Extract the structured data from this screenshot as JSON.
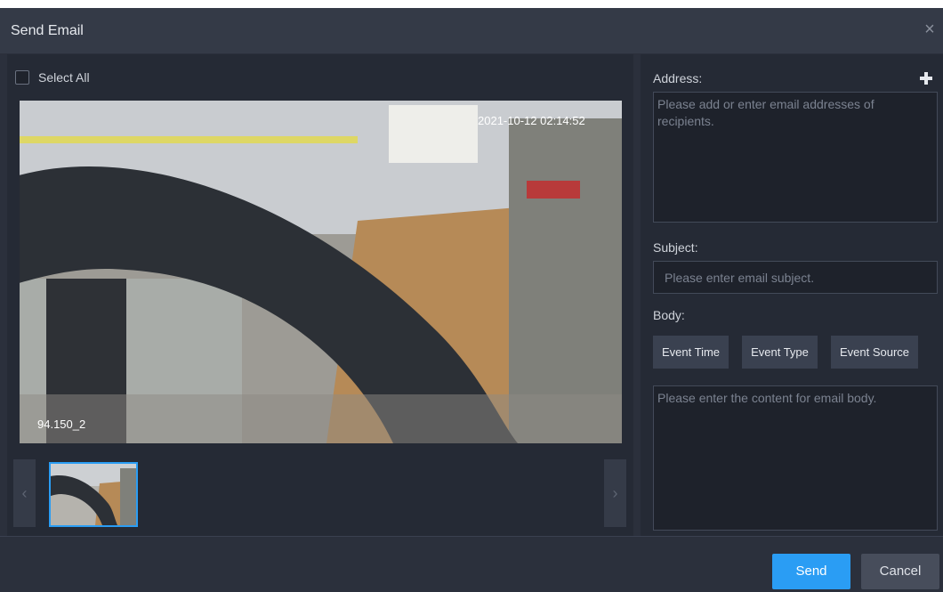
{
  "dialog": {
    "title": "Send Email"
  },
  "left": {
    "select_all_label": "Select All",
    "select_all_checked": false,
    "image": {
      "timestamp_overlay": "2021-10-12 02:14:52",
      "channel_overlay": "94.150_2"
    },
    "thumbnails": [
      {
        "selected": true
      }
    ],
    "prev_icon": "chevron-left-icon",
    "next_icon": "chevron-right-icon"
  },
  "right": {
    "address_label": "Address:",
    "address_placeholder": "Please add or enter email addresses of recipients.",
    "add_icon": "plus-icon",
    "subject_label": "Subject:",
    "subject_placeholder": "Please enter email subject.",
    "body_label": "Body:",
    "tags": [
      "Event Time",
      "Event Type",
      "Event Source"
    ],
    "body_placeholder": "Please enter the content for email body."
  },
  "footer": {
    "send_label": "Send",
    "cancel_label": "Cancel"
  },
  "colors": {
    "accent": "#2a9df4",
    "background": "#2b303c",
    "panel": "#252a35"
  }
}
